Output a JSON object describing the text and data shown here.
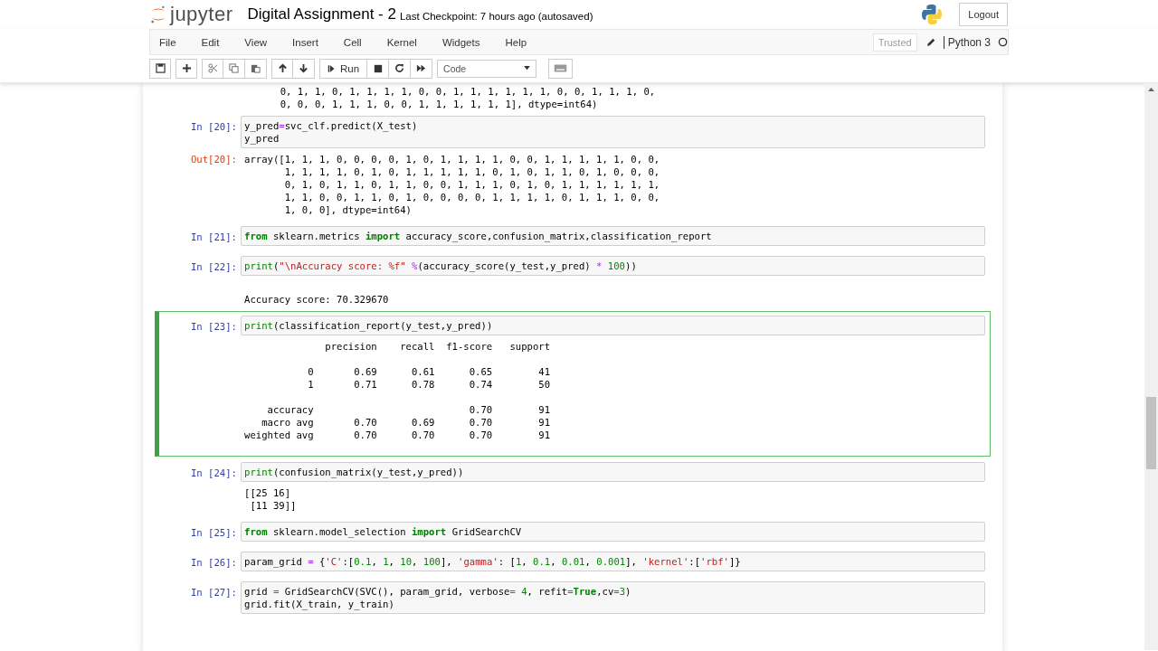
{
  "header": {
    "logo_text": "jupyter",
    "title": "Digital Assignment - 2",
    "checkpoint": "Last Checkpoint: 7 hours ago (autosaved)",
    "logout": "Logout"
  },
  "menu": [
    "File",
    "Edit",
    "View",
    "Insert",
    "Cell",
    "Kernel",
    "Widgets",
    "Help"
  ],
  "kernel": {
    "trusted": "Trusted",
    "name": "Python 3",
    "busy": false
  },
  "toolbar": {
    "run_label": "Run",
    "cell_type": "Code"
  },
  "top_output": "       0, 1, 1, 0, 1, 1, 1, 1, 0, 0, 1, 1, 1, 1, 1, 1, 0, 0, 1, 1, 1, 0,\n       0, 0, 0, 1, 1, 1, 0, 0, 1, 1, 1, 1, 1, 1], dtype=int64)",
  "cells": [
    {
      "prompt": "In [20]:",
      "selected": false,
      "code": [
        [
          {
            "text": "y_pred",
            "kind": "plain"
          },
          {
            "text": "=",
            "kind": "operator"
          },
          {
            "text": "svc_clf.predict(X_test)",
            "kind": "plain"
          }
        ],
        [
          {
            "text": "y_pred",
            "kind": "plain"
          }
        ]
      ],
      "out_prompt": "Out[20]:",
      "output": "array([1, 1, 1, 0, 0, 0, 0, 1, 0, 1, 1, 1, 1, 0, 0, 1, 1, 1, 1, 1, 0, 0,\n       1, 1, 1, 1, 0, 1, 0, 1, 1, 1, 1, 1, 0, 1, 0, 1, 1, 0, 1, 0, 0, 0,\n       0, 1, 0, 1, 1, 0, 1, 1, 0, 0, 1, 1, 1, 0, 1, 0, 1, 1, 1, 1, 1, 1,\n       1, 1, 0, 0, 1, 1, 0, 1, 0, 0, 0, 0, 1, 1, 1, 1, 0, 1, 1, 1, 0, 0,\n       1, 0, 0], dtype=int64)"
    },
    {
      "prompt": "In [21]:",
      "selected": false,
      "code": [
        [
          {
            "text": "from",
            "kind": "keyword"
          },
          {
            "text": " sklearn.metrics ",
            "kind": "plain"
          },
          {
            "text": "import",
            "kind": "keyword"
          },
          {
            "text": " accuracy_score,confusion_matrix,classification_report",
            "kind": "plain"
          }
        ]
      ]
    },
    {
      "prompt": "In [22]:",
      "selected": false,
      "code": [
        [
          {
            "text": "print",
            "kind": "builtin"
          },
          {
            "text": "(",
            "kind": "plain"
          },
          {
            "text": "\"\\nAccuracy score: %f\"",
            "kind": "string"
          },
          {
            "text": " %",
            "kind": "operator"
          },
          {
            "text": "(accuracy_score(y_test,y_pred) ",
            "kind": "plain"
          },
          {
            "text": "*",
            "kind": "operator"
          },
          {
            "text": " 100",
            "kind": "number"
          },
          {
            "text": "))",
            "kind": "plain"
          }
        ]
      ],
      "output": "\nAccuracy score: 70.329670"
    },
    {
      "prompt": "In [23]:",
      "selected": true,
      "code": [
        [
          {
            "text": "print",
            "kind": "builtin"
          },
          {
            "text": "(classification_report(y_test,y_pred))",
            "kind": "plain"
          }
        ]
      ],
      "output": "              precision    recall  f1-score   support\n\n           0       0.69      0.61      0.65        41\n           1       0.71      0.78      0.74        50\n\n    accuracy                           0.70        91\n   macro avg       0.70      0.69      0.70        91\nweighted avg       0.70      0.70      0.70        91"
    },
    {
      "prompt": "In [24]:",
      "selected": false,
      "code": [
        [
          {
            "text": "print",
            "kind": "builtin"
          },
          {
            "text": "(confusion_matrix(y_test,y_pred))",
            "kind": "plain"
          }
        ]
      ],
      "output": "[[25 16]\n [11 39]]"
    },
    {
      "prompt": "In [25]:",
      "selected": false,
      "code": [
        [
          {
            "text": "from",
            "kind": "keyword"
          },
          {
            "text": " sklearn.model_selection ",
            "kind": "plain"
          },
          {
            "text": "import",
            "kind": "keyword"
          },
          {
            "text": " GridSearchCV",
            "kind": "plain"
          }
        ]
      ]
    },
    {
      "prompt": "In [26]:",
      "selected": false,
      "code": [
        [
          {
            "text": "param_grid ",
            "kind": "plain"
          },
          {
            "text": "=",
            "kind": "operator"
          },
          {
            "text": " {",
            "kind": "plain"
          },
          {
            "text": "'C'",
            "kind": "string"
          },
          {
            "text": ":[",
            "kind": "plain"
          },
          {
            "text": "0.1",
            "kind": "number"
          },
          {
            "text": ", ",
            "kind": "plain"
          },
          {
            "text": "1",
            "kind": "number"
          },
          {
            "text": ", ",
            "kind": "plain"
          },
          {
            "text": "10",
            "kind": "number"
          },
          {
            "text": ", ",
            "kind": "plain"
          },
          {
            "text": "100",
            "kind": "number"
          },
          {
            "text": "], ",
            "kind": "plain"
          },
          {
            "text": "'gamma'",
            "kind": "string"
          },
          {
            "text": ": [",
            "kind": "plain"
          },
          {
            "text": "1",
            "kind": "number"
          },
          {
            "text": ", ",
            "kind": "plain"
          },
          {
            "text": "0.1",
            "kind": "number"
          },
          {
            "text": ", ",
            "kind": "plain"
          },
          {
            "text": "0.01",
            "kind": "number"
          },
          {
            "text": ", ",
            "kind": "plain"
          },
          {
            "text": "0.001",
            "kind": "number"
          },
          {
            "text": "], ",
            "kind": "plain"
          },
          {
            "text": "'kernel'",
            "kind": "string"
          },
          {
            "text": ":[",
            "kind": "plain"
          },
          {
            "text": "'rbf'",
            "kind": "string"
          },
          {
            "text": "]}",
            "kind": "plain"
          }
        ]
      ]
    },
    {
      "prompt": "In [27]:",
      "selected": false,
      "code": [
        [
          {
            "text": "grid ",
            "kind": "plain"
          },
          {
            "text": "=",
            "kind": "operator"
          },
          {
            "text": " GridSearchCV(SVC(), param_grid, verbose",
            "kind": "plain"
          },
          {
            "text": "=",
            "kind": "operator"
          },
          {
            "text": " 4",
            "kind": "number"
          },
          {
            "text": ", refit",
            "kind": "plain"
          },
          {
            "text": "=",
            "kind": "operator"
          },
          {
            "text": "True",
            "kind": "keyword"
          },
          {
            "text": ",cv",
            "kind": "plain"
          },
          {
            "text": "=",
            "kind": "operator"
          },
          {
            "text": "3",
            "kind": "number"
          },
          {
            "text": ")",
            "kind": "plain"
          }
        ],
        [
          {
            "text": "grid.fit(X_train, y_train)",
            "kind": "plain"
          }
        ]
      ]
    }
  ]
}
